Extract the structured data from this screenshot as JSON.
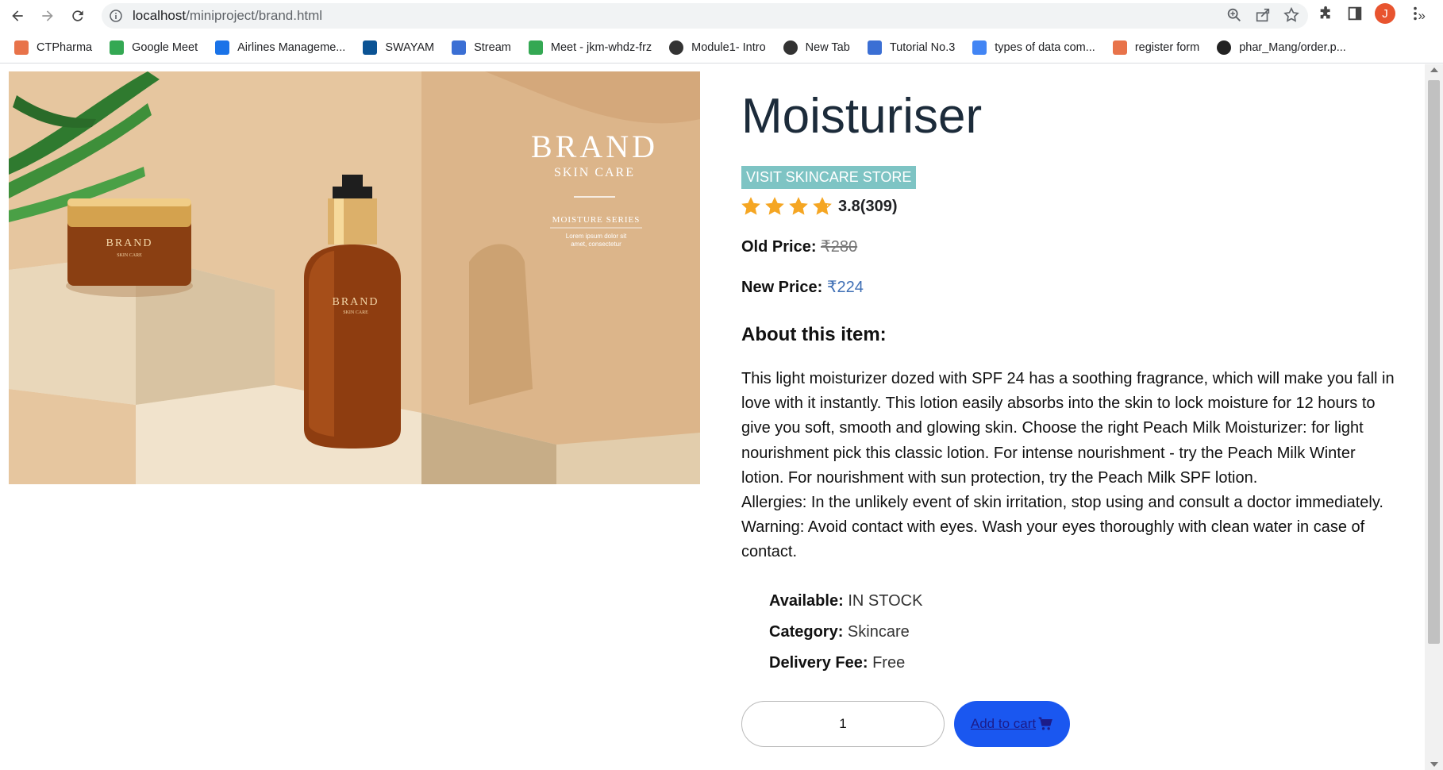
{
  "browser": {
    "url_host": "localhost",
    "url_path": "/miniproject/brand.html",
    "avatar_letter": "J"
  },
  "bookmarks": [
    {
      "label": "CTPharma",
      "icon": "orange-square-icon",
      "color": "#e8734a"
    },
    {
      "label": "Google Meet",
      "icon": "meet-icon",
      "color": "#34a853"
    },
    {
      "label": "Airlines Manageme...",
      "icon": "f-icon",
      "color": "#1a73e8"
    },
    {
      "label": "SWAYAM",
      "icon": "swayam-icon",
      "color": "#0b5394"
    },
    {
      "label": "Stream",
      "icon": "stream-icon",
      "color": "#3b6fd4"
    },
    {
      "label": "Meet - jkm-whdz-frz",
      "icon": "meet-icon",
      "color": "#34a853"
    },
    {
      "label": "Module1- Intro",
      "icon": "globe-icon",
      "color": "#333333"
    },
    {
      "label": "New Tab",
      "icon": "globe-icon",
      "color": "#333333"
    },
    {
      "label": "Tutorial No.3",
      "icon": "person-icon",
      "color": "#3b6fd4"
    },
    {
      "label": "types of data com...",
      "icon": "google-icon",
      "color": "#4285f4"
    },
    {
      "label": "register form",
      "icon": "orange-square-icon",
      "color": "#e8734a"
    },
    {
      "label": "phar_Mang/order.p...",
      "icon": "github-icon",
      "color": "#222222"
    }
  ],
  "image": {
    "brand": "BRAND",
    "subtitle": "SKIN CARE",
    "series": "MOISTURE SERIES",
    "lorem1": "Lorem ipsum dolor sit",
    "lorem2": "amet, consectetur"
  },
  "product": {
    "title": "Moisturiser",
    "store_button": "VISIT SKINCARE STORE",
    "rating_value": 3.8,
    "rating_text": "3.8(309)",
    "old_price_label": "Old Price:",
    "old_price": "₹280",
    "new_price_label": "New Price:",
    "new_price": "₹224",
    "about_heading": "About this item:",
    "desc1": "This light moisturizer dozed with SPF 24 has a soothing fragrance, which will make you fall in love with it instantly. This lotion easily absorbs into the skin to lock moisture for 12 hours to give you soft, smooth and glowing skin. Choose the right Peach Milk Moisturizer: for light nourishment pick this classic lotion. For intense nourishment - try the Peach Milk Winter lotion. For nourishment with sun protection, try the Peach Milk SPF lotion.",
    "desc2": "Allergies: In the unlikely event of skin irritation, stop using and consult a doctor immediately.",
    "desc3": "Warning: Avoid contact with eyes. Wash your eyes thoroughly with clean water in case of contact.",
    "available_label": "Available:",
    "available": "IN STOCK",
    "category_label": "Category:",
    "category": "Skincare",
    "delivery_label": "Delivery Fee:",
    "delivery": "Free",
    "quantity": "1",
    "add_to_cart": "Add to cart"
  },
  "colors": {
    "accent_store": "#7ec4c4",
    "star": "#f5a623",
    "new_price": "#3f6fb5",
    "cart_button": "#1a57f0"
  }
}
